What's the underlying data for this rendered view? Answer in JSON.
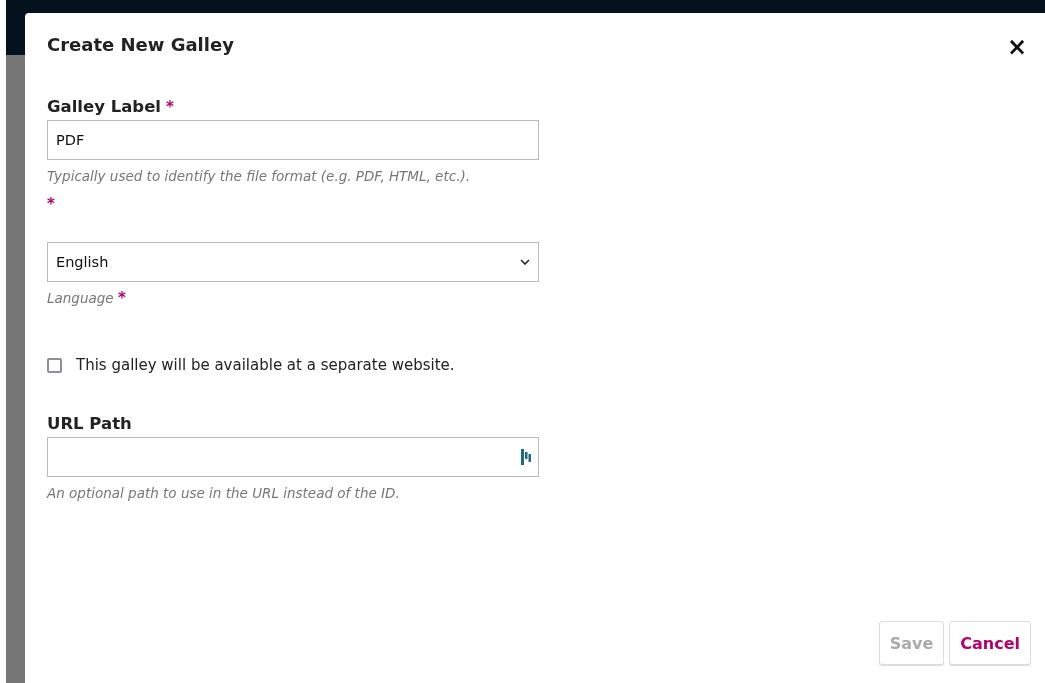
{
  "dialog": {
    "title": "Create New Galley",
    "close": "×"
  },
  "fields": [
    {
      "kind": "text",
      "label": "Galley Label",
      "required_mark": "*",
      "value": "PDF",
      "help": "Typically used to identify the file format (e.g. PDF, HTML, etc.).",
      "help_mark": "*"
    },
    {
      "kind": "select",
      "value": "English",
      "help": "Language",
      "help_mark": "*"
    },
    {
      "kind": "checkbox",
      "label": "This galley will be available at a separate website.",
      "checked": false
    },
    {
      "kind": "text",
      "label": "URL Path",
      "help": "An optional path to use in the URL instead of the ID.",
      "extension_icon": true
    }
  ],
  "buttons": [
    {
      "kind": "save",
      "label": "Save",
      "disabled": true
    },
    {
      "kind": "cancel",
      "label": "Cancel",
      "disabled": false
    }
  ]
}
